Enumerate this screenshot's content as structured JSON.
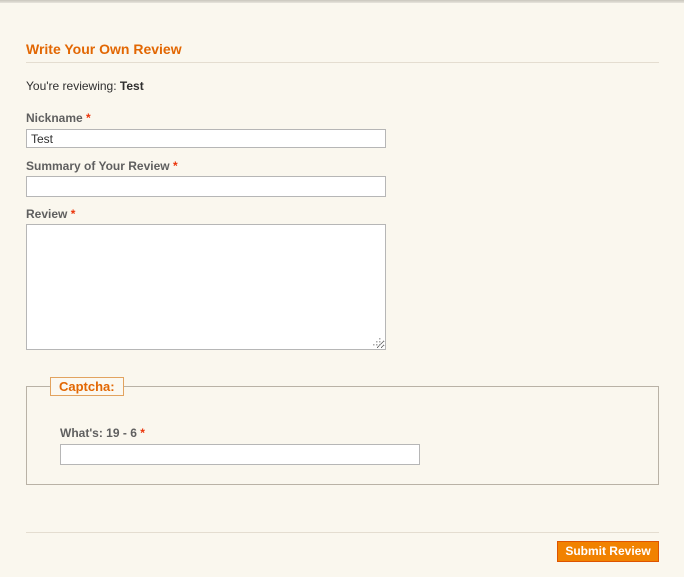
{
  "form": {
    "heading": "Write Your Own Review",
    "reviewing_prefix": "You're reviewing:",
    "product_name": "Test",
    "required_marker": "*",
    "nickname": {
      "label": "Nickname",
      "value": "Test"
    },
    "summary": {
      "label": "Summary of Your Review",
      "value": ""
    },
    "review": {
      "label": "Review",
      "value": ""
    },
    "captcha": {
      "legend": "Captcha:",
      "question": "What's: 19 - 6",
      "value": ""
    },
    "submit_label": "Submit Review"
  },
  "colors": {
    "background": "#faf7ee",
    "accent": "#e26703",
    "button": "#f18200",
    "required": "#eb340a"
  }
}
